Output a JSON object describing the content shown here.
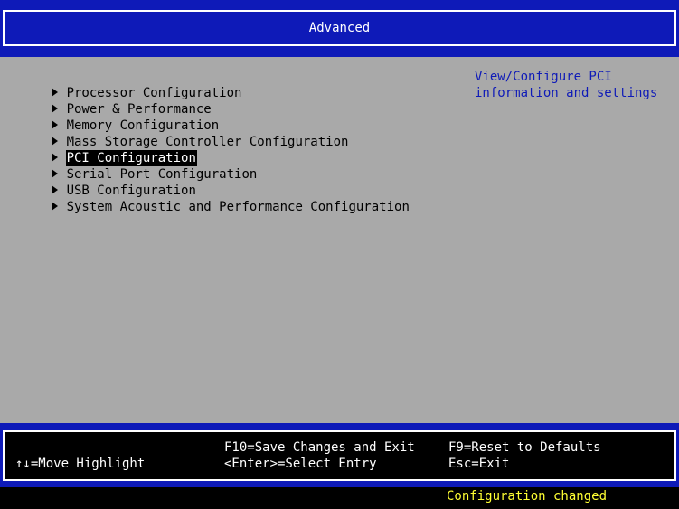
{
  "header": {
    "title": "Advanced"
  },
  "menu": {
    "items": [
      {
        "label": "Processor Configuration",
        "selected": false
      },
      {
        "label": "Power & Performance",
        "selected": false
      },
      {
        "label": "Memory Configuration",
        "selected": false
      },
      {
        "label": "Mass Storage Controller Configuration",
        "selected": false
      },
      {
        "label": "PCI Configuration",
        "selected": true
      },
      {
        "label": "Serial Port Configuration",
        "selected": false
      },
      {
        "label": "USB Configuration",
        "selected": false
      },
      {
        "label": "System Acoustic and Performance Configuration",
        "selected": false
      }
    ]
  },
  "help": {
    "text": "View/Configure PCI\ninformation and settings"
  },
  "footer": {
    "move_highlight": "↑↓=Move Highlight",
    "save_exit": "F10=Save Changes and Exit",
    "select_entry": "<Enter>=Select Entry",
    "reset_defaults": "F9=Reset to Defaults",
    "esc_exit": "Esc=Exit"
  },
  "status": {
    "message": "Configuration changed"
  },
  "colors": {
    "bios_blue": "#0e1ab8",
    "background_gray": "#a9a9a9",
    "status_yellow": "#ffff33"
  }
}
